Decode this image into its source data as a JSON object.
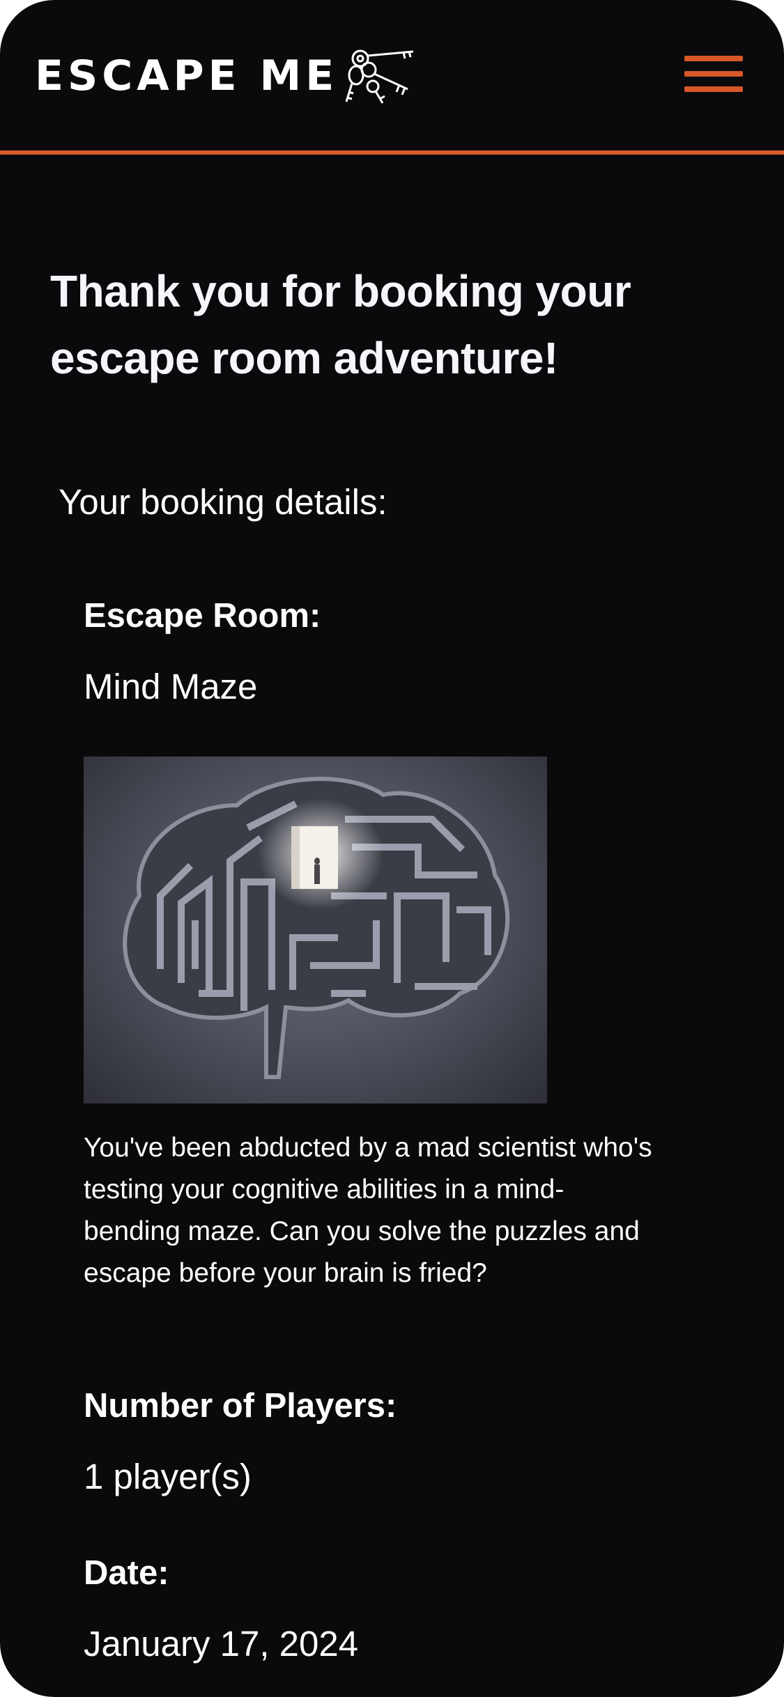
{
  "header": {
    "brand": "ESCAPE ME",
    "logo_icon": "keys-icon",
    "menu_icon": "hamburger-menu-icon",
    "accent_color": "#d8582a"
  },
  "confirmation": {
    "title": "Thank you for booking your escape room adventure!",
    "details_heading": "Your booking details:"
  },
  "booking": {
    "room_label": "Escape Room:",
    "room_name": "Mind Maze",
    "room_image": "brain-maze-image",
    "room_description": "You've been abducted by a mad scientist who's testing your cognitive abilities in a mind-bending maze. Can you solve the puzzles and escape before your brain is fried?",
    "players_label": "Number of Players:",
    "players_value": "1 player(s)",
    "date_label": "Date:",
    "date_value": "January 17, 2024"
  },
  "colors": {
    "background": "#0a0a0c",
    "text": "#ffffff"
  }
}
